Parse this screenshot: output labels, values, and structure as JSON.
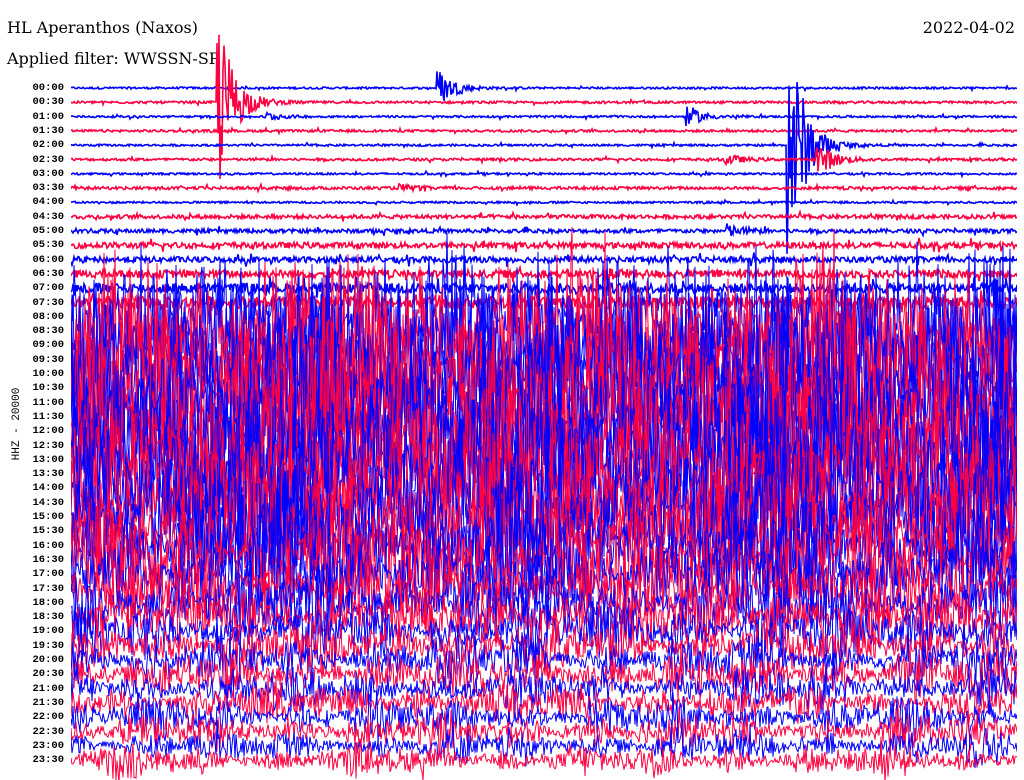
{
  "header": {
    "station": "HL Aperanthos (Naxos)",
    "filter": "Applied filter: WWSSN-SP",
    "date": "2022-04-02"
  },
  "chart_data": {
    "type": "line",
    "title": "HL Aperanthos (Naxos)",
    "subtitle": "Applied filter: WWSSN-SP",
    "ylabel": "HHZ - 20000",
    "xlabel": "",
    "row_minutes": 30,
    "colors": [
      "#0000ff",
      "#ff0040"
    ],
    "row_labels": [
      "00:00",
      "00:30",
      "01:00",
      "01:30",
      "02:00",
      "02:30",
      "03:00",
      "03:30",
      "04:00",
      "04:30",
      "05:00",
      "05:30",
      "06:00",
      "06:30",
      "07:00",
      "07:30",
      "08:00",
      "08:30",
      "09:00",
      "09:30",
      "10:00",
      "10:30",
      "11:00",
      "11:30",
      "12:00",
      "12:30",
      "13:00",
      "13:30",
      "14:00",
      "14:30",
      "15:00",
      "15:30",
      "16:00",
      "16:30",
      "17:00",
      "17:30",
      "18:00",
      "18:30",
      "19:00",
      "19:30",
      "20:00",
      "20:30",
      "21:00",
      "21:30",
      "22:00",
      "22:30",
      "23:00",
      "23:30"
    ],
    "relative_noise": [
      1,
      1.2,
      1,
      1.2,
      1,
      1.3,
      1,
      1.5,
      1,
      2,
      2,
      3,
      3,
      4,
      5,
      6,
      120,
      130,
      140,
      150,
      150,
      150,
      150,
      150,
      150,
      150,
      150,
      140,
      140,
      130,
      120,
      110,
      100,
      90,
      80,
      70,
      60,
      55,
      50,
      45,
      40,
      38,
      36,
      34,
      32,
      30,
      28,
      26
    ],
    "events": [
      {
        "row": 0,
        "minute": 11.7,
        "amplitude": 18
      },
      {
        "row": 1,
        "minute": 4.7,
        "amplitude": 90
      },
      {
        "row": 2,
        "minute": 6.2,
        "amplitude": 4
      },
      {
        "row": 2,
        "minute": 19.6,
        "amplitude": 9
      },
      {
        "row": 4,
        "minute": 22.8,
        "amplitude": 120
      },
      {
        "row": 5,
        "minute": 20.8,
        "amplitude": 5
      },
      {
        "row": 5,
        "minute": 23.7,
        "amplitude": 18
      },
      {
        "row": 7,
        "minute": 10.5,
        "amplitude": 3
      },
      {
        "row": 10,
        "minute": 20.8,
        "amplitude": 6
      },
      {
        "row": 13,
        "minute": 17.0,
        "amplitude": 4
      }
    ]
  }
}
